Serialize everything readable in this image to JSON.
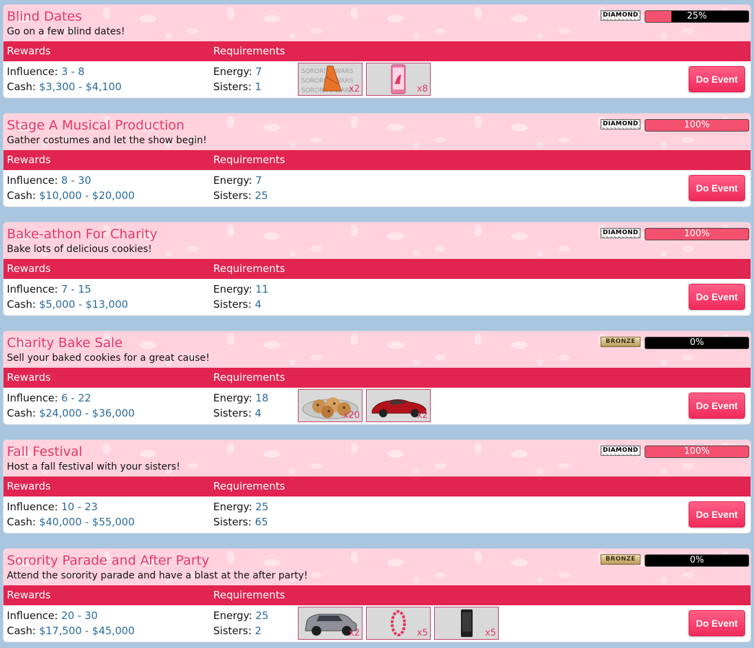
{
  "events": [
    {
      "title": "Blind Dates",
      "description": "Go on a few blind dates!",
      "tier": "DIAMOND",
      "progress": 25,
      "progress_label": "25%",
      "rewards_header": "Rewards",
      "requirements_header": "Requirements",
      "influence_label": "Influence:",
      "influence_range": "3 - 8",
      "cash_label": "Cash:",
      "cash_range": "$3,300 - $4,100",
      "energy_label": "Energy:",
      "energy": "7",
      "sisters_label": "Sisters:",
      "sisters": "1",
      "items": [
        {
          "icon": "dress-icon",
          "qty": "x2"
        },
        {
          "icon": "phone-icon",
          "qty": "x8"
        }
      ],
      "button_label": "Do Event"
    },
    {
      "title": "Stage A Musical Production",
      "description": "Gather costumes and let the show begin!",
      "tier": "DIAMOND",
      "progress": 100,
      "progress_label": "100%",
      "rewards_header": "Rewards",
      "requirements_header": "Requirements",
      "influence_label": "Influence:",
      "influence_range": "8 - 30",
      "cash_label": "Cash:",
      "cash_range": "$10,000 - $20,000",
      "energy_label": "Energy:",
      "energy": "7",
      "sisters_label": "Sisters:",
      "sisters": "25",
      "items": [],
      "button_label": "Do Event"
    },
    {
      "title": "Bake-athon For Charity",
      "description": "Bake lots of delicious cookies!",
      "tier": "DIAMOND",
      "progress": 100,
      "progress_label": "100%",
      "rewards_header": "Rewards",
      "requirements_header": "Requirements",
      "influence_label": "Influence:",
      "influence_range": "7 - 15",
      "cash_label": "Cash:",
      "cash_range": "$5,000 - $13,000",
      "energy_label": "Energy:",
      "energy": "11",
      "sisters_label": "Sisters:",
      "sisters": "4",
      "items": [],
      "button_label": "Do Event"
    },
    {
      "title": "Charity Bake Sale",
      "description": "Sell your baked cookies for a great cause!",
      "tier": "BRONZE",
      "progress": 0,
      "progress_label": "0%",
      "rewards_header": "Rewards",
      "requirements_header": "Requirements",
      "influence_label": "Influence:",
      "influence_range": "6 - 22",
      "cash_label": "Cash:",
      "cash_range": "$24,000 - $36,000",
      "energy_label": "Energy:",
      "energy": "18",
      "sisters_label": "Sisters:",
      "sisters": "4",
      "items": [
        {
          "icon": "cookies-icon",
          "qty": "x20"
        },
        {
          "icon": "sports-car-icon",
          "qty": "x2"
        }
      ],
      "button_label": "Do Event"
    },
    {
      "title": "Fall Festival",
      "description": "Host a fall festival with your sisters!",
      "tier": "DIAMOND",
      "progress": 100,
      "progress_label": "100%",
      "rewards_header": "Rewards",
      "requirements_header": "Requirements",
      "influence_label": "Influence:",
      "influence_range": "10 - 23",
      "cash_label": "Cash:",
      "cash_range": "$40,000 - $55,000",
      "energy_label": "Energy:",
      "energy": "25",
      "sisters_label": "Sisters:",
      "sisters": "65",
      "items": [],
      "button_label": "Do Event"
    },
    {
      "title": "Sorority Parade and After Party",
      "description": "Attend the sorority parade and have a blast at the after party!",
      "tier": "BRONZE",
      "progress": 0,
      "progress_label": "0%",
      "rewards_header": "Rewards",
      "requirements_header": "Requirements",
      "influence_label": "Influence:",
      "influence_range": "20 - 30",
      "cash_label": "Cash:",
      "cash_range": "$17,500 - $45,000",
      "energy_label": "Energy:",
      "energy": "25",
      "sisters_label": "Sisters:",
      "sisters": "2",
      "items": [
        {
          "icon": "suv-icon",
          "qty": "x2"
        },
        {
          "icon": "lei-necklace-icon",
          "qty": "x5"
        },
        {
          "icon": "smartphone-icon",
          "qty": "x5"
        }
      ],
      "button_label": "Do Event"
    }
  ]
}
